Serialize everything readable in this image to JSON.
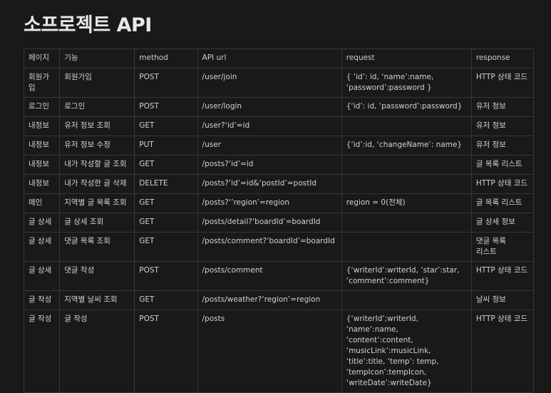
{
  "title": "소프로젝트 API",
  "columns": [
    "페이지",
    "기능",
    "method",
    "API url",
    "request",
    "response"
  ],
  "rows": [
    {
      "page": "회원가입",
      "feature": "회원가입",
      "method": "POST",
      "url": "/user/join",
      "request": "{ ‘id’: id, ‘name’:name, ‘password’:password }",
      "response": "HTTP 상태 코드"
    },
    {
      "page": "로그인",
      "feature": "로그인",
      "method": "POST",
      "url": "/user/login",
      "request": "{‘id’: id, ‘password’:password}",
      "response": "유저 정보"
    },
    {
      "page": "내정보",
      "feature": "유저 정보 조회",
      "method": "GET",
      "url": "/user?‘id’=id",
      "request": "",
      "response": "유저 정보"
    },
    {
      "page": "내정보",
      "feature": "유저 정보 수정",
      "method": "PUT",
      "url": "/user",
      "request": "{‘id’:id, ‘changeName’: name}",
      "response": "유저 정보"
    },
    {
      "page": "내정보",
      "feature": "내가 작성할 글 조회",
      "method": "GET",
      "url": "/posts?‘id’=id",
      "request": "",
      "response": "글 목록 리스트"
    },
    {
      "page": "내정보",
      "feature": "내가 작성한 글 삭제",
      "method": "DELETE",
      "url": "/posts?‘id’=id&‘postId’=postId",
      "request": "",
      "response": "HTTP 상태 코드"
    },
    {
      "page": "메인",
      "feature": "지역별 글 목록 조회",
      "method": "GET",
      "url": "/posts?‘’region’=region",
      "request": "region = 0(전체)",
      "response": "글 목록 리스트"
    },
    {
      "page": "글 상세",
      "feature": "글 상세 조회",
      "method": "GET",
      "url": "/posts/detail?‘boardId’=boardId",
      "request": "",
      "response": "글 상세 정보"
    },
    {
      "page": "글 상세",
      "feature": "댓글 목록 조회",
      "method": "GET",
      "url": "/posts/comment?‘boardId’=boardId",
      "request": "",
      "response": "댓글 목록 리스트"
    },
    {
      "page": "글 상세",
      "feature": "댓글 작성",
      "method": "POST",
      "url": "/posts/comment",
      "request": "{‘writerId’:writerId, ‘star’:star, ‘comment’:comment}",
      "response": "HTTP 상태 코드"
    },
    {
      "page": "글 작성",
      "feature": "지역별 날씨 조회",
      "method": "GET",
      "url": "/posts/weather?‘region’=region",
      "request": "",
      "response": "날씨 정보"
    },
    {
      "page": "글 작성",
      "feature": "글 작성",
      "method": "POST",
      "url": "/posts",
      "request": "{‘writerId’;writerId, ‘name’:name, ‘content’:content, ‘musicLink’:musicLink, ‘title’:title, ‘temp’: temp, ‘tempIcon’:tempIcon, ‘writeDate’:writeDate}",
      "response": "HTTP 상태 코드"
    }
  ]
}
